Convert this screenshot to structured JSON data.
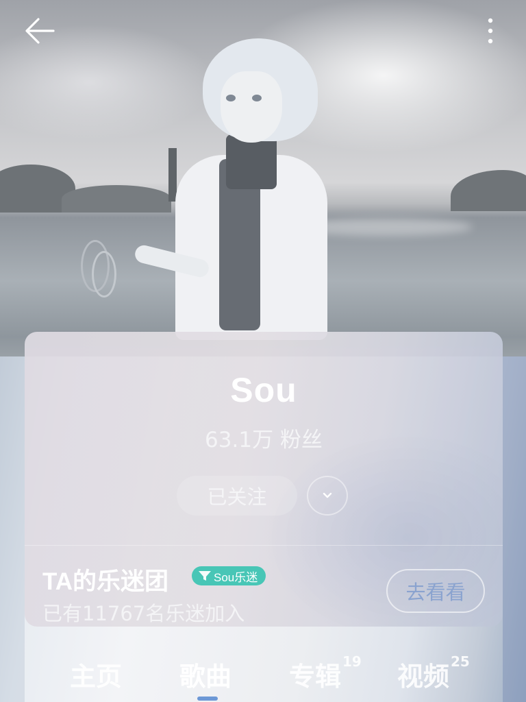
{
  "topbar": {
    "back_icon": "arrow-left-icon",
    "more_icon": "more-vertical-icon"
  },
  "artist": {
    "name": "Sou",
    "fans": "63.1万 粉丝",
    "follow_label": "已关注",
    "dropdown_icon": "chevron-down-icon"
  },
  "fanclub": {
    "title": "TA的乐迷团",
    "badge": "Sou乐迷",
    "badge_icon": "funnel-badge-icon",
    "subtitle": "已有11767名乐迷加入",
    "button_label": "去看看"
  },
  "tabs": [
    {
      "label": "主页",
      "count": ""
    },
    {
      "label": "歌曲",
      "count": ""
    },
    {
      "label": "专辑",
      "count": "19"
    },
    {
      "label": "视频",
      "count": "25"
    }
  ],
  "active_tab": "歌曲",
  "colors": {
    "badge": "#48c6b6",
    "go_see_text": "#8aa3cf",
    "tab_indicator": "#6d98d6"
  }
}
